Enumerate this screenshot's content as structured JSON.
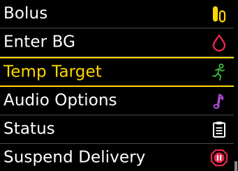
{
  "menu": {
    "items": [
      {
        "label": "Bolus",
        "icon": "bolus-icon",
        "color": "#ffd700",
        "selected": false
      },
      {
        "label": "Enter BG",
        "icon": "blood-drop-icon",
        "color": "#e8274b",
        "selected": false
      },
      {
        "label": "Temp Target",
        "icon": "running-person-icon",
        "color": "#3fbf3f",
        "selected": true
      },
      {
        "label": "Audio Options",
        "icon": "music-note-icon",
        "color": "#b04ad8",
        "selected": false
      },
      {
        "label": "Status",
        "icon": "clipboard-icon",
        "color": "#ffffff",
        "selected": false
      },
      {
        "label": "Suspend Delivery",
        "icon": "pause-octagon-icon",
        "color": "#e8274b",
        "selected": false
      }
    ]
  },
  "colors": {
    "background": "#000000",
    "selection": "#ffd700",
    "text": "#ffffff",
    "divider": "#4a4a4a"
  }
}
